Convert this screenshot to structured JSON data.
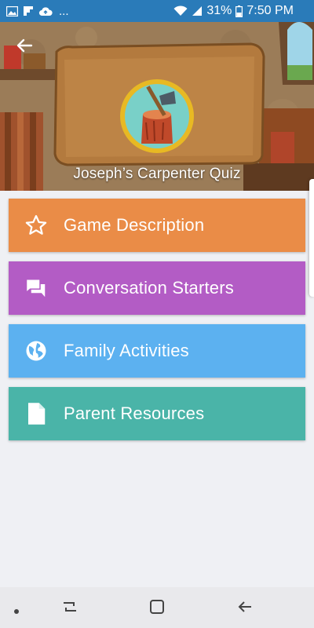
{
  "status_bar": {
    "left_icons": [
      "image-icon",
      "flipboard-icon",
      "cloud-upload-icon"
    ],
    "overflow": "...",
    "battery_percent": "31%",
    "time": "7:50 PM"
  },
  "header": {
    "title": "Joseph’s Carpenter Quiz"
  },
  "menu": {
    "items": [
      {
        "label": "Game Description",
        "icon": "star-outline-icon",
        "color": "#ea8c47"
      },
      {
        "label": "Conversation Starters",
        "icon": "chat-bubbles-icon",
        "color": "#b35cc5"
      },
      {
        "label": "Family Activities",
        "icon": "globe-icon",
        "color": "#5cb1f0"
      },
      {
        "label": "Parent Resources",
        "icon": "document-icon",
        "color": "#4ab4a8"
      }
    ]
  },
  "colors": {
    "status_bar": "#2a7bb9",
    "background": "#eff0f4"
  }
}
